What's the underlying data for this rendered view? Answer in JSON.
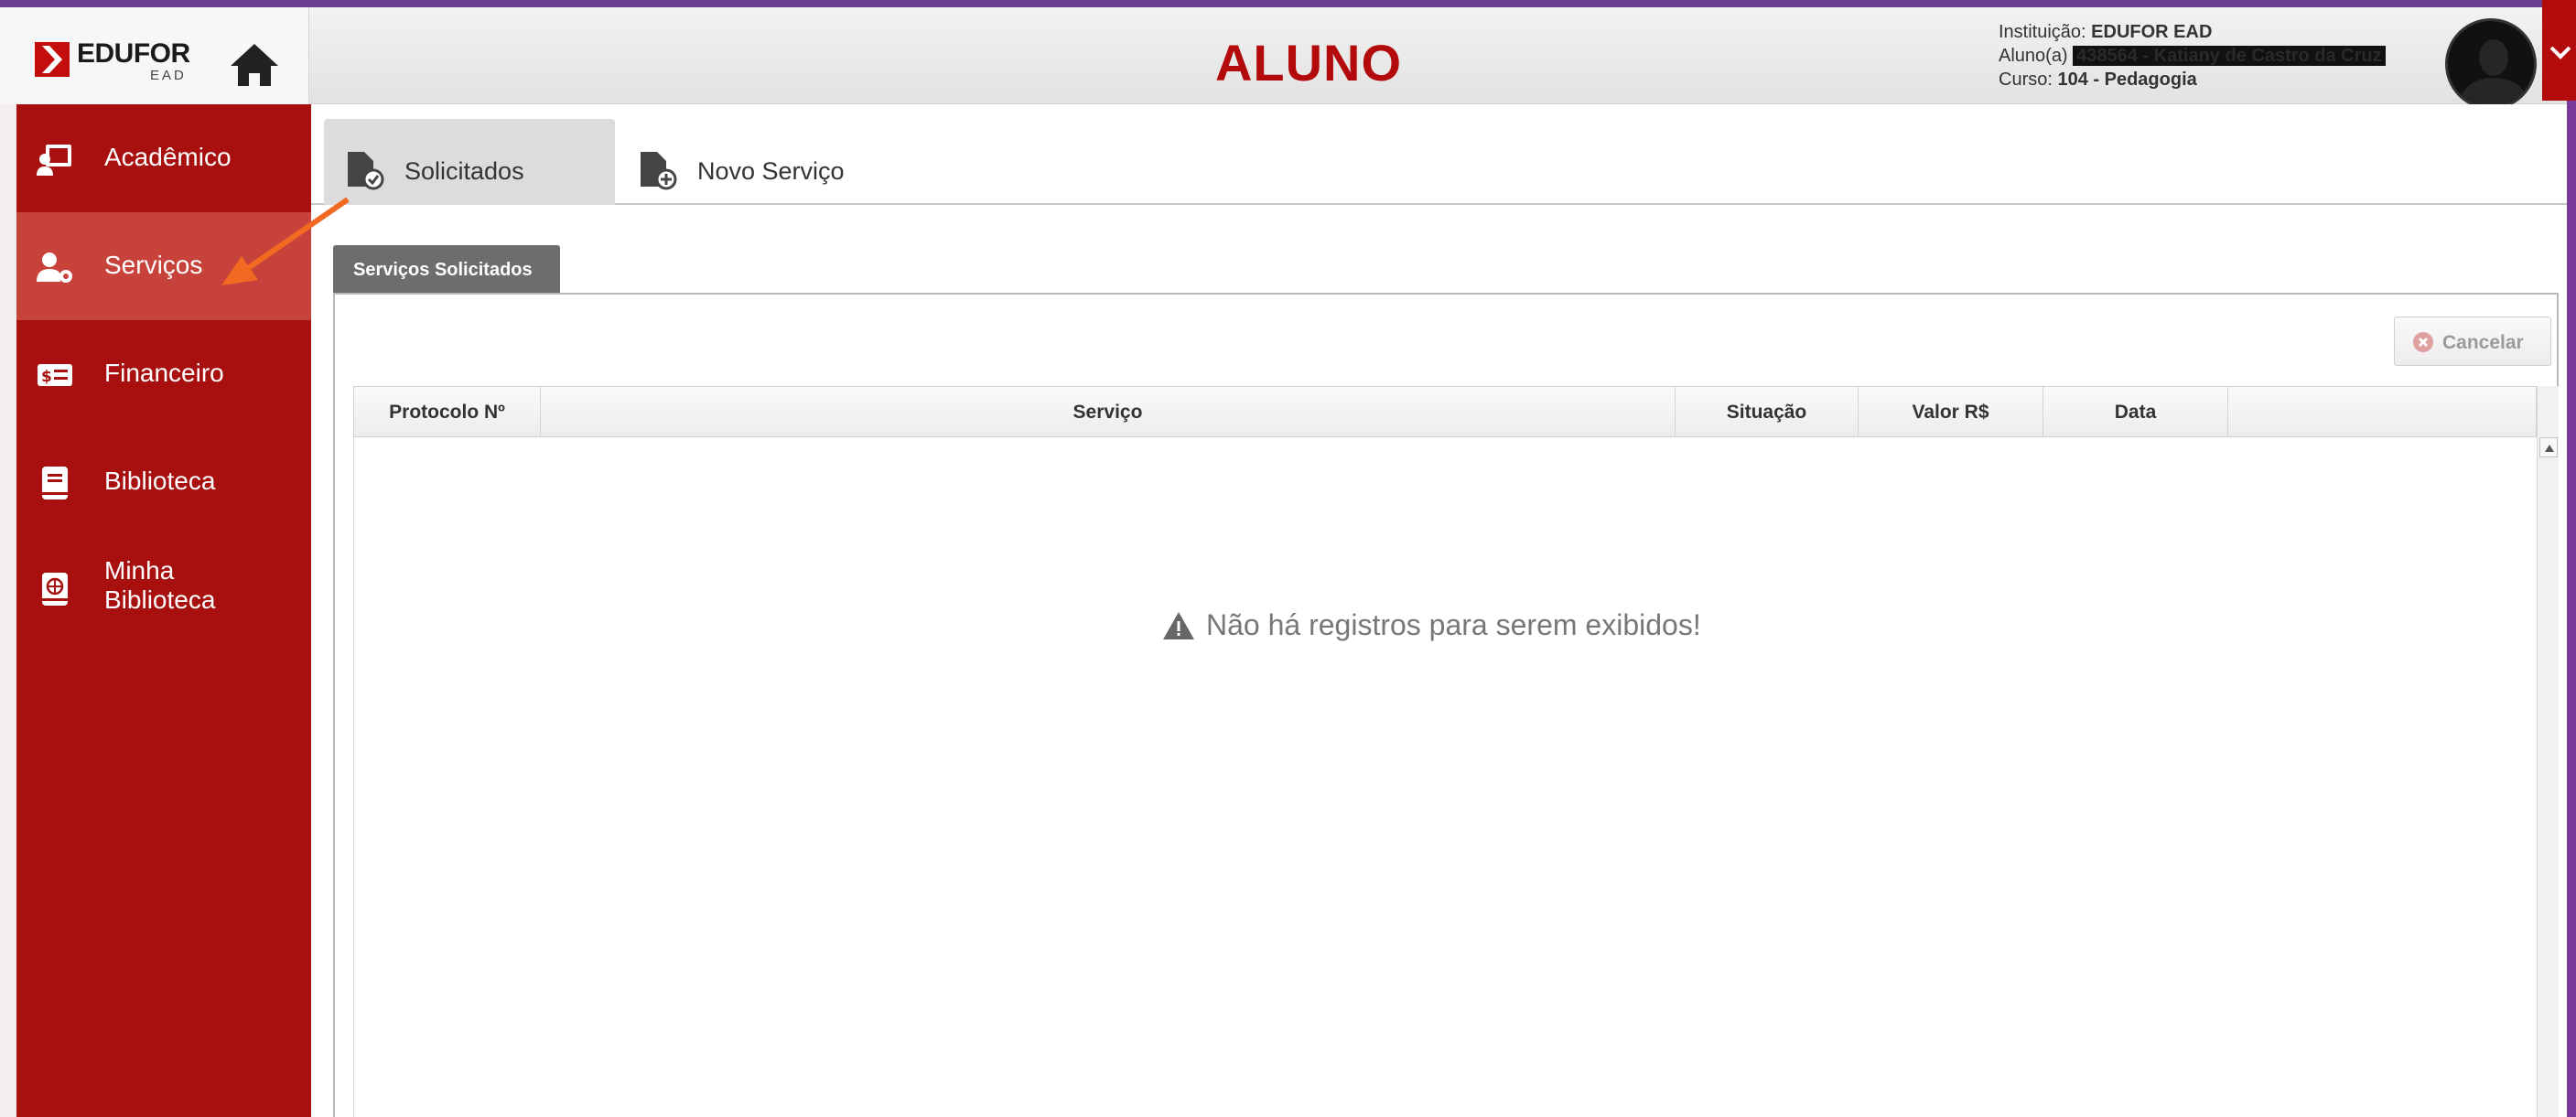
{
  "header": {
    "logo_text": "EDUFOR",
    "logo_sub": "EAD",
    "page_title": "ALUNO",
    "info": {
      "institution_label": "Instituição:",
      "institution_value": "EDUFOR EAD",
      "student_label": "Aluno(a)",
      "student_value": "438564 - Katiany de Castro da Cruz",
      "course_label": "Curso:",
      "course_value": "104 - Pedagogia"
    },
    "home_icon": "home-icon",
    "profile_toggle_icon": "chevron-down-icon"
  },
  "sidebar": {
    "items": [
      {
        "label": "Acadêmico",
        "icon": "classroom-icon",
        "active": false
      },
      {
        "label": "Serviços",
        "icon": "user-gear-icon",
        "active": true
      },
      {
        "label": "Financeiro",
        "icon": "money-icon",
        "active": false
      },
      {
        "label": "Biblioteca",
        "icon": "book-icon",
        "active": false
      },
      {
        "label": "Minha Biblioteca",
        "label_line1": "Minha",
        "label_line2": "Biblioteca",
        "icon": "globe-book-icon",
        "active": false
      }
    ]
  },
  "tabs": [
    {
      "label": "Solicitados",
      "icon": "file-check-icon",
      "active": true
    },
    {
      "label": "Novo Serviço",
      "icon": "file-plus-icon",
      "active": false
    }
  ],
  "panel": {
    "title": "Serviços Solicitados",
    "cancel_label": "Cancelar",
    "columns": [
      "Protocolo Nº",
      "Serviço",
      "Situação",
      "Valor R$",
      "Data",
      ""
    ],
    "rows": [],
    "empty_message": "Não há registros para serem exibidos!"
  },
  "colors": {
    "brand_red": "#b30b0b",
    "sidebar_bg": "#a80f0f",
    "sidebar_active": "#c8423c",
    "annotation_arrow": "#f26a21"
  }
}
